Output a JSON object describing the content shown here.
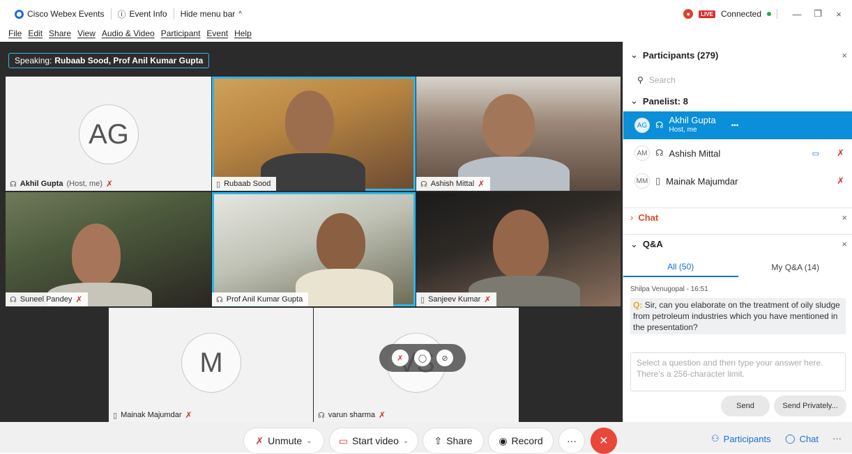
{
  "titlebar": {
    "app_name": "Cisco Webex Events",
    "event_info": "Event Info",
    "hide_menu": "Hide menu bar",
    "hide_menu_arrow": "^",
    "live": "LIVE",
    "status": "Connected",
    "minimize": "—",
    "restore": "❐",
    "close": "×"
  },
  "menu": [
    "File",
    "Edit",
    "Share",
    "View",
    "Audio & Video",
    "Participant",
    "Event",
    "Help"
  ],
  "speaking": {
    "label": "Speaking:",
    "names": "Rubaab Sood, Prof Anil Kumar Gupta"
  },
  "tiles": [
    {
      "name": "Akhil Gupta",
      "suffix": "(Host, me)",
      "initials": "AG",
      "muted": true
    },
    {
      "name": "Rubaab Sood",
      "active": true
    },
    {
      "name": "Ashish Mittal",
      "muted": true
    },
    {
      "name": "Suneel Pandey",
      "muted": true
    },
    {
      "name": "Prof Anil Kumar Gupta",
      "active": true
    },
    {
      "name": "Sanjeev Kumar",
      "muted": true
    },
    {
      "name": "Mainak Majumdar",
      "initials": "M",
      "muted": true
    },
    {
      "name": "varun sharma",
      "initials": "VS",
      "muted": true
    }
  ],
  "controls": {
    "unmute": "Unmute",
    "start_video": "Start video",
    "share": "Share",
    "record": "Record",
    "more": "···",
    "participants": "Participants",
    "chat": "Chat",
    "more_right": "···"
  },
  "panel": {
    "participants_title": "Participants (279)",
    "search_placeholder": "Search",
    "panelist_title": "Panelist: 8",
    "panelists": [
      {
        "initials": "AG",
        "name": "Akhil Gupta",
        "role": "Host, me"
      },
      {
        "initials": "AM",
        "name": "Ashish Mittal"
      },
      {
        "initials": "MM",
        "name": "Mainak Majumdar"
      }
    ],
    "chat_title": "Chat",
    "qa_title": "Q&A",
    "tab_all": "All (50)",
    "tab_mine": "My Q&A (14)",
    "question_meta": "Shilpa Venugopal - 16:51",
    "question_prefix": "Q:",
    "question_text": "Sir, can you elaborate on  the treatment  of oily sludge from petroleum industries which you have mentioned in the presentation?",
    "answer_placeholder": "Select a question and then type your answer here. There's a 256-character limit.",
    "send": "Send",
    "send_privately": "Send Privately..."
  }
}
